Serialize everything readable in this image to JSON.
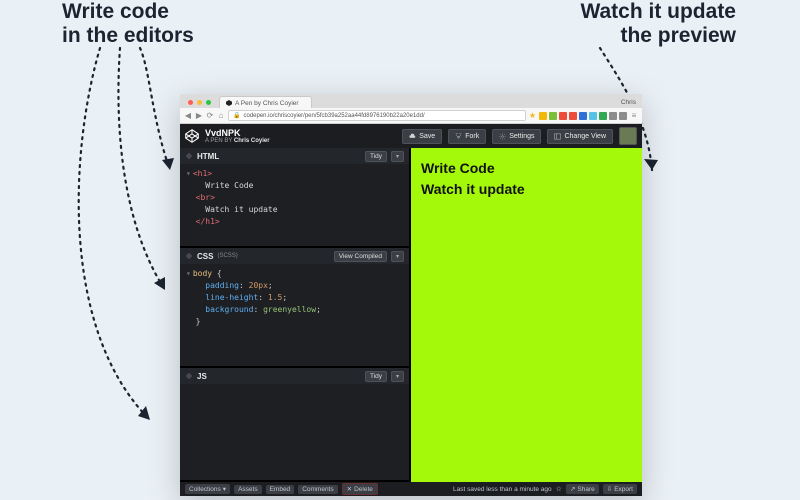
{
  "annotations": {
    "left_line1": "Write code",
    "left_line2": "in the editors",
    "right_line1": "Watch it update",
    "right_line2": "the preview"
  },
  "browser": {
    "tab_title": "A Pen by Chris Coyier",
    "username_top": "Chris",
    "url": "codepen.io/chriscoyier/pen/5fcb39a252aa44fd8976190b22a20e1dd/",
    "ext_colors": [
      "#f2b90c",
      "#7bbf3a",
      "#ef4d3c",
      "#ef4d3c",
      "#2f6fd6",
      "#58c2e6",
      "#33a852",
      "#8c8c8c",
      "#8c8c8c"
    ]
  },
  "pen": {
    "title": "VvdNPK",
    "byline_prefix": "A PEN BY",
    "author": "Chris Coyier",
    "buttons": {
      "save": "Save",
      "fork": "Fork",
      "settings": "Settings",
      "change_view": "Change View"
    }
  },
  "editors": {
    "html": {
      "label": "HTML",
      "tidy": "Tidy",
      "code_lines": [
        "<h1>",
        "  Write Code",
        "  <br>",
        "  Watch it update",
        "</h1>"
      ]
    },
    "css": {
      "label": "CSS",
      "sublabel": "(SCSS)",
      "compiled": "View Compiled",
      "code": {
        "selector": "body",
        "props": [
          {
            "k": "padding",
            "v": "20px"
          },
          {
            "k": "line-height",
            "v": "1.5"
          },
          {
            "k": "background",
            "v": "greenyellow"
          }
        ]
      }
    },
    "js": {
      "label": "JS",
      "tidy": "Tidy"
    }
  },
  "preview": {
    "line1": "Write Code",
    "line2": "Watch it update"
  },
  "footer": {
    "collections": "Collections",
    "assets": "Assets",
    "embed": "Embed",
    "comments": "Comments",
    "delete": "Delete",
    "saved_text": "Last saved less than a minute ago",
    "share": "Share",
    "export": "Export"
  }
}
